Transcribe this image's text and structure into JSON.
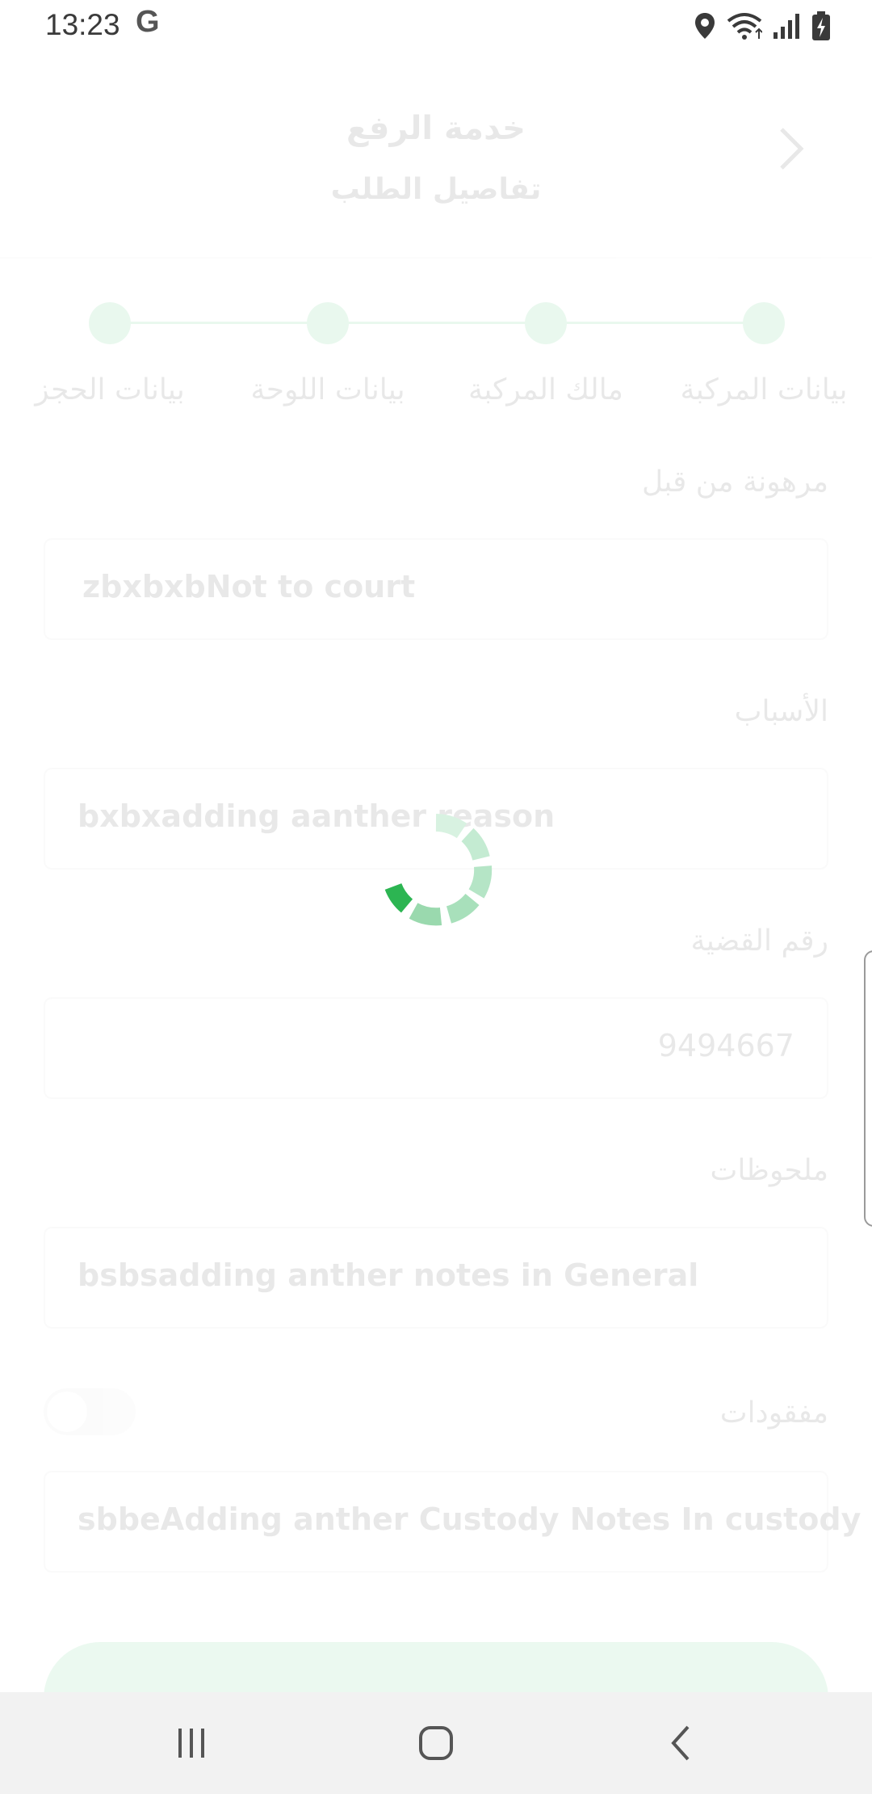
{
  "status_bar": {
    "time": "13:23",
    "google_badge": "G",
    "icons": [
      "location-icon",
      "wifi-icon",
      "signal-icon",
      "battery-charging-icon"
    ]
  },
  "header": {
    "title": "خدمة الرفع",
    "subtitle": "تفاصيل الطلب"
  },
  "stepper": {
    "steps": [
      {
        "label": "بيانات المركبة"
      },
      {
        "label": "مالك المركبة"
      },
      {
        "label": "بيانات اللوحة"
      },
      {
        "label": "بيانات الحجز"
      }
    ]
  },
  "form": {
    "mortgaged": {
      "label": "مرهونة من قبل",
      "value": "zbxbxbNot to court"
    },
    "reasons": {
      "label": "الأسباب",
      "value": "bxbxadding aanther reason"
    },
    "case_number": {
      "label": "رقم القضية",
      "value": "9494667"
    },
    "notes": {
      "label": "ملحوظات",
      "value": "bsbsadding anther notes in General"
    },
    "missing": {
      "label": "مفقودات",
      "value": "sbbeAdding anther Custody Notes In custody",
      "toggle_on": false
    }
  },
  "colors": {
    "accent": "#1db954",
    "spinner_dark": "#2cb552",
    "spinner_light": "#a8e0bb"
  },
  "loading": true
}
